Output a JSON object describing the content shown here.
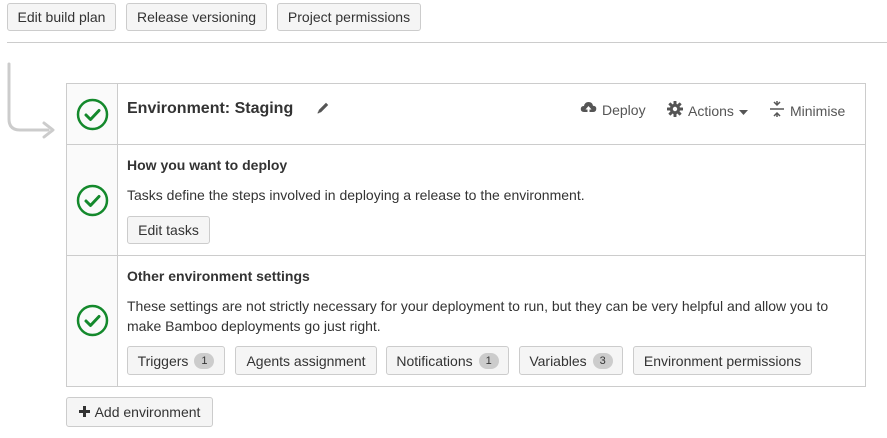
{
  "top_buttons": {
    "edit_build_plan": "Edit build plan",
    "release_versioning": "Release versioning",
    "project_permissions": "Project permissions"
  },
  "environment": {
    "title": "Environment: Staging",
    "actions": {
      "deploy": "Deploy",
      "actions": "Actions",
      "minimise": "Minimise"
    },
    "deploy_section": {
      "heading": "How you want to deploy",
      "description": "Tasks define the steps involved in deploying a release to the environment.",
      "edit_tasks": "Edit tasks"
    },
    "settings_section": {
      "heading": "Other environment settings",
      "description_line1": "These settings are not strictly necessary for your deployment to run, but they can be very helpful and allow you to",
      "description_line2": "make Bamboo deployments go just right.",
      "buttons": {
        "triggers": {
          "label": "Triggers",
          "count": "1"
        },
        "agents": {
          "label": "Agents assignment"
        },
        "notifications": {
          "label": "Notifications",
          "count": "1"
        },
        "variables": {
          "label": "Variables",
          "count": "3"
        },
        "permissions": {
          "label": "Environment permissions"
        }
      }
    }
  },
  "add_environment": "Add environment",
  "colors": {
    "check_green": "#14892c",
    "border": "#cccccc",
    "button_bg": "#f5f5f5",
    "badge_bg": "#cccccc",
    "connector": "#cccccc"
  },
  "icons": {
    "status": "check-circle-icon",
    "edit": "pencil-icon",
    "deploy": "cloud-upload-icon",
    "actions": "gear-icon",
    "dropdown": "caret-down-icon",
    "minimise": "collapse-icon",
    "add": "plus-icon"
  }
}
